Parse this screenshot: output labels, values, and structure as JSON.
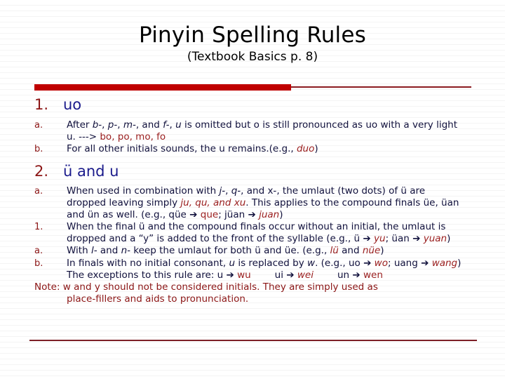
{
  "slide": {
    "title": "Pinyin Spelling Rules",
    "subtitle": "(Textbook Basics p. 8)",
    "colors": {
      "accent_bar": "#c00000",
      "thin_rule": "#8b1a20",
      "bottom_rule": "#7d1f27",
      "heading_text": "#1a1a8c",
      "marker": "#8c1515",
      "body_text": "#10103c",
      "example_red": "#9c2020",
      "background": "#ffffff"
    }
  },
  "sections": [
    {
      "marker": "1.",
      "heading": "uo",
      "items": [
        {
          "marker": "a.",
          "line1_pre": "After ",
          "b_dash": "b-",
          "sep1": ", ",
          "p_dash": "p-",
          "sep2": ", ",
          "m_dash": "m-",
          "sep3": ", and ",
          "f_dash": "f-",
          "sep4": ", ",
          "u_ital": "u",
          "line1_post": " is omitted but o is still pronounced as uo with a very light u.  ---> ",
          "examples": "bo, po, mo, fo"
        },
        {
          "marker": "b.",
          "text_pre": "For all other initials sounds, the u remains.(e.g., ",
          "example": "duo",
          "text_post": ")"
        }
      ]
    },
    {
      "marker": "2.",
      "heading": "ü and u",
      "items": [
        {
          "marker": "a.",
          "pre": "When used in combination with ",
          "j_dash": "j-",
          "sep1": ", ",
          "q_dash": "q-",
          "sep2": ", and ",
          "x_dash": "x-",
          "mid": ", the umlaut (two dots) of ü are dropped leaving simply ",
          "ex1": "ju, qu, and xu",
          "mid2": ". This applies to the compound finals üe, üan and ün as well. (e.g., qüe ",
          "arrow1": "➔",
          "ex2": "que",
          "mid3": "; jüan ",
          "arrow2": "➔",
          "ex3": "juan",
          "post": ")"
        },
        {
          "marker": "1.",
          "pre": "When the final ü and the compound finals occur without an initial, the umlaut is dropped and a “y” is added to the front of the syllable (e.g., ü ",
          "arrow1": "➔",
          "ex1": "yu",
          "mid": "; üan ",
          "arrow2": "➔",
          "ex2": "yuan",
          "post": ")"
        },
        {
          "marker": "a.",
          "pre": "With ",
          "l_dash": "l-",
          "sep1": " and ",
          "n_dash": "n-",
          "mid": " keep the umlaut for both ü and üe. (e.g., ",
          "ex1": "lü",
          "mid2": " and ",
          "ex2": "nüe",
          "post": ")"
        },
        {
          "marker": "b.",
          "pre": "In finals with no initial consonant, ",
          "u_ital": "u",
          "mid": " is replaced by ",
          "w_ital": "w",
          "mid2": ". (e.g., uo ",
          "arrow1": "➔",
          "ex1": "wo",
          "mid3": "; uang ",
          "arrow2": "➔",
          "ex2": "wang",
          "post": ")"
        },
        {
          "marker": "",
          "exceptions_pre": "The exceptions to this rule are: u ",
          "arrow1": "➔",
          "ex1": "wu",
          "gap1": " ",
          "mid1": "ui ",
          "arrow2": "➔",
          "ex2": "wei",
          "gap2": " ",
          "mid2": "un ",
          "arrow3": "➔",
          "ex3": "wen"
        }
      ]
    }
  ],
  "note": {
    "line1": "Note: w and y should not be considered initials. They are simply used as",
    "line2": "place-fillers and aids to pronunciation."
  }
}
